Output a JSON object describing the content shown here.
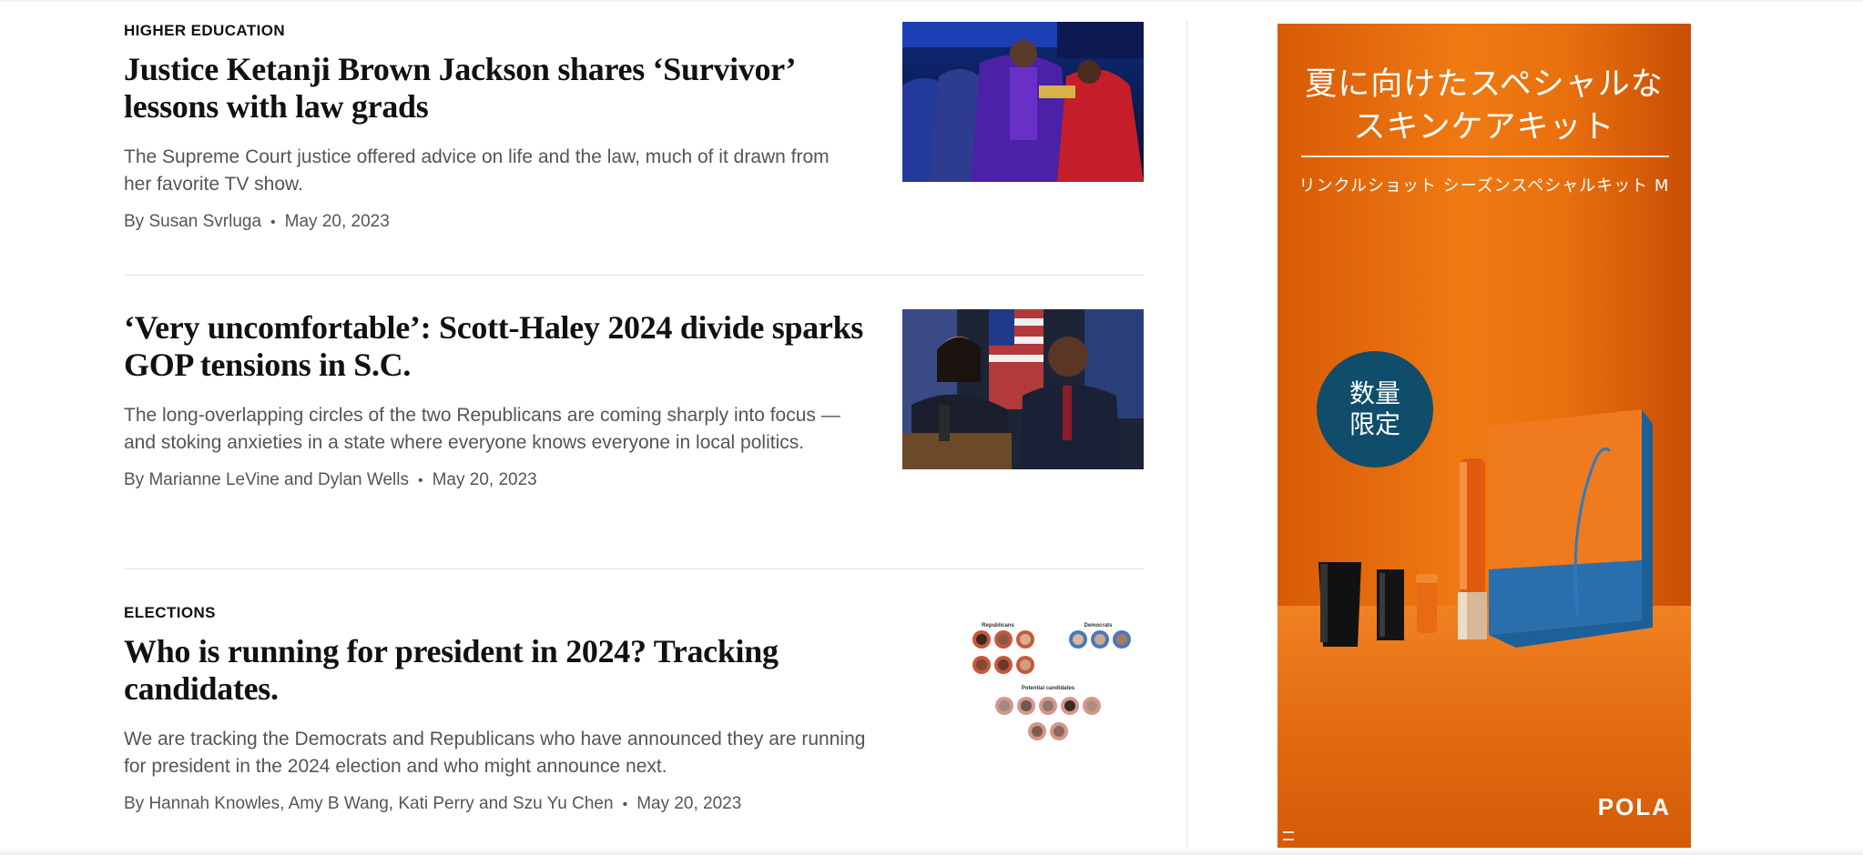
{
  "stories": [
    {
      "kicker": "HIGHER EDUCATION",
      "headline": "Justice Ketanji Brown Jackson shares ‘Survivor’ lessons with law grads",
      "blurb": "The Supreme Court justice offered advice on life and the law, much of it drawn from her favorite TV show.",
      "byline": "By Susan Svrluga",
      "date": "May 20, 2023",
      "image_alt": "Ketanji Brown Jackson receiving academic hood at commencement"
    },
    {
      "kicker": "",
      "headline": "‘Very uncomfortable’: Scott-Haley 2024 divide sparks GOP tensions in S.C.",
      "blurb": "The long-overlapping circles of the two Republicans are coming sharply into focus — and stoking anxieties in a state where everyone knows everyone in local politics.",
      "byline": "By Marianne LeVine and Dylan Wells",
      "date": "May 20, 2023",
      "image_alt": "Nikki Haley and Tim Scott at a podium with flags"
    },
    {
      "kicker": "ELECTIONS",
      "headline": "Who is running for president in 2024? Tracking candidates.",
      "blurb": "We are tracking the Democrats and Republicans who have announced they are running for president in the 2024 election and who might announce next.",
      "byline": "By Hannah Knowles, Amy B Wang, Kati Perry and Szu Yu Chen",
      "date": "May 20, 2023",
      "image_alt": "Grid of candidate portraits"
    }
  ],
  "candidates_graphic": {
    "republicans_label": "Republicans",
    "democrats_label": "Democrats",
    "potential_label": "Potential candidates"
  },
  "ad": {
    "title_line1": "夏に向けたスペシャルな",
    "title_line2": "スキンケアキット",
    "subtitle": "リンクルショット シーズンスペシャルキット M",
    "badge_line1": "数量",
    "badge_line2": "限定",
    "brand": "POLA",
    "colors": {
      "background": "#e8700e",
      "badge": "#0f4d6a",
      "box_side": "#1d5f98"
    }
  }
}
